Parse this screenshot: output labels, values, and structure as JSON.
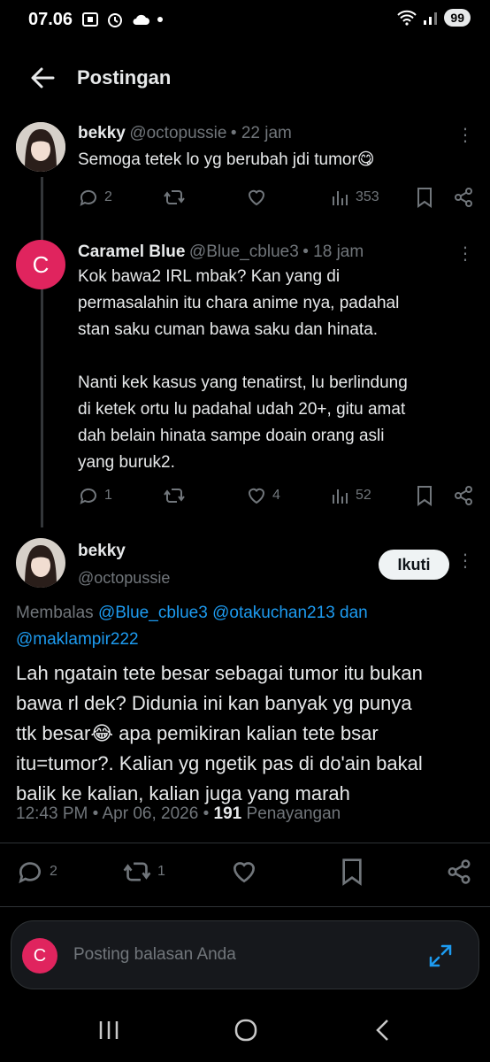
{
  "status_bar": {
    "time": "07.06",
    "battery": "99"
  },
  "header": {
    "title": "Postingan"
  },
  "tweets": [
    {
      "name": "bekky",
      "handle": "@octopussie",
      "time": "• 22 jam",
      "text": "Semoga tetek lo yg berubah jdi tumor😋",
      "replies": "2",
      "retweets": "",
      "likes": "",
      "views": "353"
    },
    {
      "avatar_letter": "C",
      "name": "Caramel Blue",
      "handle": "@Blue_cblue3",
      "time": "• 18 jam",
      "text_lines": [
        "Kok bawa2 IRL mbak? Kan yang di",
        "permasalahin itu chara anime nya, padahal",
        "stan saku cuman bawa saku dan hinata.",
        "",
        "Nanti kek kasus yang tenatirst, lu berlindung",
        "di ketek ortu lu padahal udah 20+, gitu amat",
        "dah belain hinata sampe doain orang asli",
        "yang buruk2."
      ],
      "replies": "1",
      "retweets": "",
      "likes": "4",
      "views": "52"
    }
  ],
  "main_tweet": {
    "name": "bekky",
    "handle": "@octopussie",
    "follow_label": "Ikuti",
    "replying_prefix": "Membalas",
    "replying_1": "@Blue_cblue3",
    "replying_2": "@otakuchan213",
    "replying_and": "dan",
    "replying_3": "@maklampir222",
    "text_lines": [
      "Lah ngatain tete besar sebagai tumor itu bukan",
      "bawa rl dek? Didunia ini kan banyak yg punya",
      "ttk besar😂 apa pemikiran kalian tete bsar",
      "itu=tumor?. Kalian yg ngetik pas di do'ain bakal",
      "balik ke kalian, kalian juga yang marah"
    ],
    "time": "12:43 PM",
    "date": "Apr 06, 2026",
    "views_count": "191",
    "views_label": "Penayangan",
    "replies": "2",
    "retweets": "1"
  },
  "reply_box": {
    "avatar_letter": "C",
    "placeholder": "Posting balasan Anda"
  }
}
